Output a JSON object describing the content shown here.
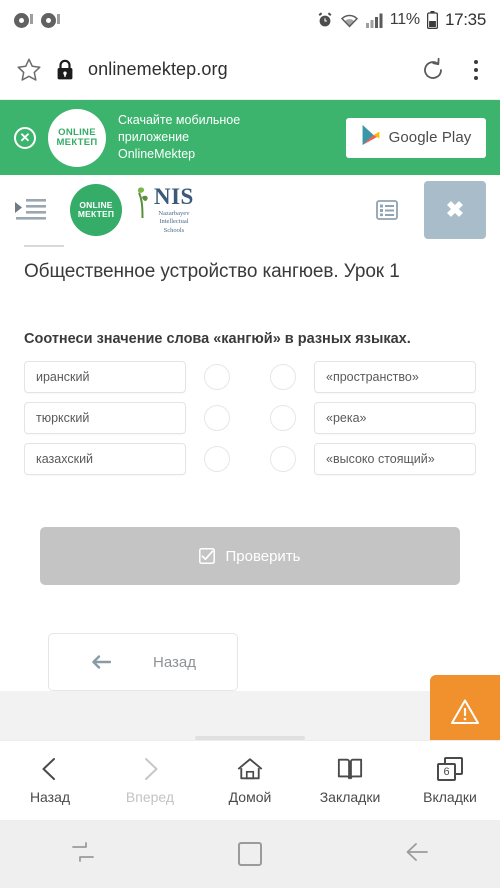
{
  "statusbar": {
    "notification_icons": [
      "notification-dot-icon",
      "notification-dot-icon"
    ],
    "alarm_icon": "alarm-icon",
    "wifi_icon": "wifi-icon",
    "signal_icon": "signal-bars-icon",
    "battery_percent": "11%",
    "battery_icon": "battery-icon",
    "clock": "17:35"
  },
  "browser": {
    "bookmark_icon": "star-icon",
    "lock_icon": "lock-icon",
    "url": "onlinemektep.org",
    "reload_icon": "reload-icon",
    "menu_icon": "kebab-menu-icon",
    "bottom_nav": [
      {
        "label": "Назад",
        "icon": "chevron-left-icon",
        "disabled": false
      },
      {
        "label": "Вперед",
        "icon": "chevron-right-icon",
        "disabled": true
      },
      {
        "label": "Домой",
        "icon": "home-icon",
        "disabled": false
      },
      {
        "label": "Закладки",
        "icon": "book-icon",
        "disabled": false
      },
      {
        "label": "Вкладки",
        "icon": "tabs-icon",
        "count": "6",
        "disabled": false
      }
    ]
  },
  "app_banner": {
    "close_icon": "close-circle-icon",
    "logo_line1": "ONLINE",
    "logo_line2": "МЕКТЕП",
    "text_line1": "Скачайте мобильное приложение",
    "text_line2": "OnlineMektep",
    "store_button": "Google Play",
    "store_icon": "google-play-icon",
    "background_color": "#3cb46e"
  },
  "site_header": {
    "menu_icon": "indent-menu-icon",
    "logo_line1": "ONLINE",
    "logo_line2": "МЕКТЕП",
    "nis_name": "NIS",
    "nis_sub_line1": "Nazarbayev",
    "nis_sub_line2": "Intellectual",
    "nis_sub_line3": "Schools",
    "list_icon": "list-icon",
    "close_icon": "close-icon"
  },
  "lesson": {
    "title": "Общественное устройство кангюев. Урок 1",
    "task": "Соотнеси значение слова «кангюй» в разных языках.",
    "left_options": [
      "иранский",
      "тюркский",
      "казахский"
    ],
    "right_options": [
      "«пространство»",
      "«река»",
      "«высоко стоящий»"
    ],
    "check_button": "Проверить",
    "check_icon": "checkbox-checked-icon",
    "check_button_color": "#c4c4c4",
    "back_button": "Назад",
    "back_icon": "arrow-left-icon"
  },
  "report_fab": {
    "icon": "warning-triangle-icon",
    "color": "#f0912d"
  },
  "android_nav": {
    "recents_icon": "recents-icon",
    "home_icon": "home-square-icon",
    "back_icon": "back-arrow-icon"
  }
}
